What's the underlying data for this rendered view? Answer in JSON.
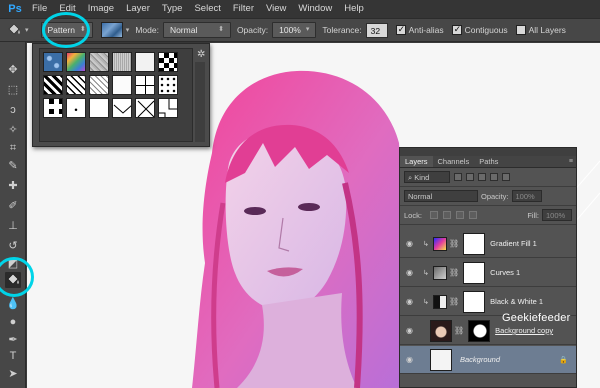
{
  "app": {
    "logo": "Ps"
  },
  "menu": [
    "File",
    "Edit",
    "Image",
    "Layer",
    "Type",
    "Select",
    "Filter",
    "View",
    "Window",
    "Help"
  ],
  "options": {
    "fill_source": "Pattern",
    "mode_label": "Mode:",
    "mode_value": "Normal",
    "opacity_label": "Opacity:",
    "opacity_value": "100%",
    "tolerance_label": "Tolerance:",
    "tolerance_value": "32",
    "anti_alias_label": "Anti-alias",
    "anti_alias_checked": true,
    "contiguous_label": "Contiguous",
    "contiguous_checked": true,
    "all_layers_label": "All Layers",
    "all_layers_checked": false
  },
  "toolbar": {
    "tools": [
      "move-tool",
      "marquee-tool",
      "lasso-tool",
      "magic-wand-tool",
      "crop-tool",
      "eyedropper-tool",
      "healing-brush-tool",
      "brush-tool",
      "clone-stamp-tool",
      "history-brush-tool",
      "eraser-tool",
      "paint-bucket-tool",
      "blur-tool",
      "dodge-tool",
      "pen-tool",
      "type-tool",
      "path-selection-tool"
    ],
    "active_tool": "paint-bucket-tool"
  },
  "pattern_picker": {
    "patterns": [
      "bubbles",
      "tie-dye",
      "gray-granite",
      "gray-noise",
      "white-square",
      "checker-bw",
      "diagonal-lines-dark",
      "diagonal-lines-2",
      "diagonal-lines-light",
      "white-paper",
      "white-grid",
      "dots-grid",
      "black-blocks",
      "white-dot",
      "white-plain",
      "zigzag",
      "x-cross",
      "corner-lines"
    ]
  },
  "layers_panel": {
    "tabs": [
      "Layers",
      "Channels",
      "Paths"
    ],
    "active_tab": "Layers",
    "filter_kind": "Kind",
    "blend_mode": "Normal",
    "opacity_label": "Opacity:",
    "opacity_value": "100%",
    "lock_label": "Lock:",
    "fill_label": "Fill:",
    "fill_value": "100%",
    "layers": [
      {
        "name": "Gradient Fill 1",
        "type": "gradient"
      },
      {
        "name": "Curves 1",
        "type": "curves"
      },
      {
        "name": "Black & White 1",
        "type": "bw"
      },
      {
        "name": "Background copy",
        "type": "image"
      },
      {
        "name": "Background",
        "type": "background"
      }
    ],
    "selected_layer": "Background"
  },
  "watermark": "Geekiefeeder",
  "colors": {
    "highlight_ring": "#00d4e8",
    "gradient_pink": "#f2459a",
    "gradient_violet": "#b86fd8",
    "selected_layer": "#6d7d92"
  }
}
